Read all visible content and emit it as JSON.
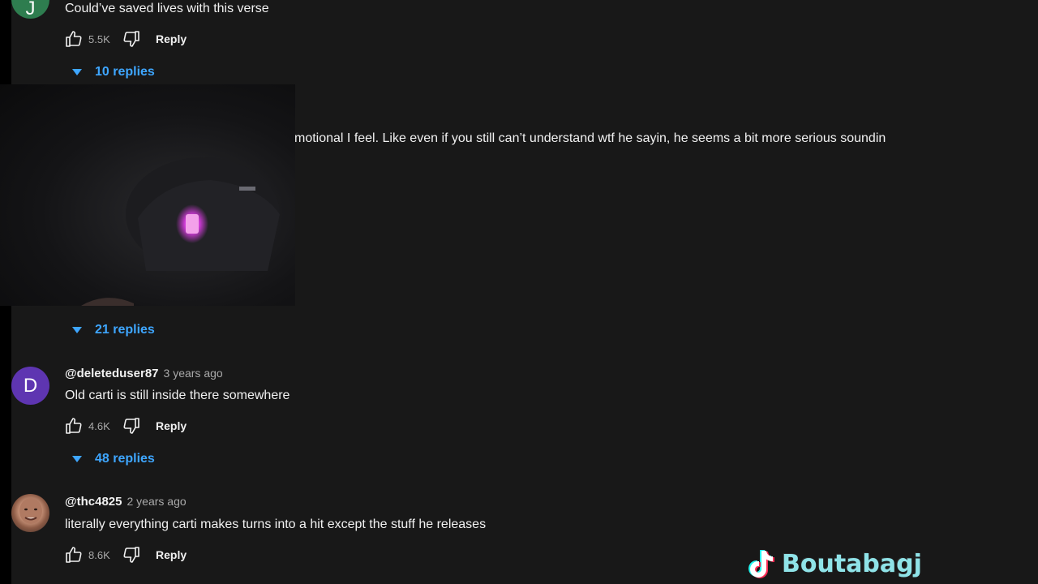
{
  "comments": [
    {
      "avatar_letter": "J",
      "text": "Could’ve saved lives with this verse",
      "likes": "5.5K",
      "reply_label": "Reply",
      "replies_label": "10 replies"
    },
    {
      "text_visible": "motional I feel. Like even if you still can’t understand wtf he sayin, he seems a bit more serious soundin",
      "replies_label": "21 replies"
    },
    {
      "avatar_letter": "D",
      "handle": "@deleteduser87",
      "time": "3 years ago",
      "text": "Old carti is still inside there somewhere",
      "likes": "4.6K",
      "reply_label": "Reply",
      "replies_label": "48 replies"
    },
    {
      "handle": "@thc4825",
      "time": "2 years ago",
      "text": "literally everything carti makes turns into a hit except the stuff he releases",
      "likes": "8.6K",
      "reply_label": "Reply"
    }
  ],
  "watermark": {
    "app_icon": "tiktok-icon",
    "name": "Boutabagj"
  },
  "colors": {
    "background": "#181818",
    "link_blue": "#3ea6ff",
    "secondary_text": "#aaaaaa",
    "watermark": "#8fe3e8"
  }
}
